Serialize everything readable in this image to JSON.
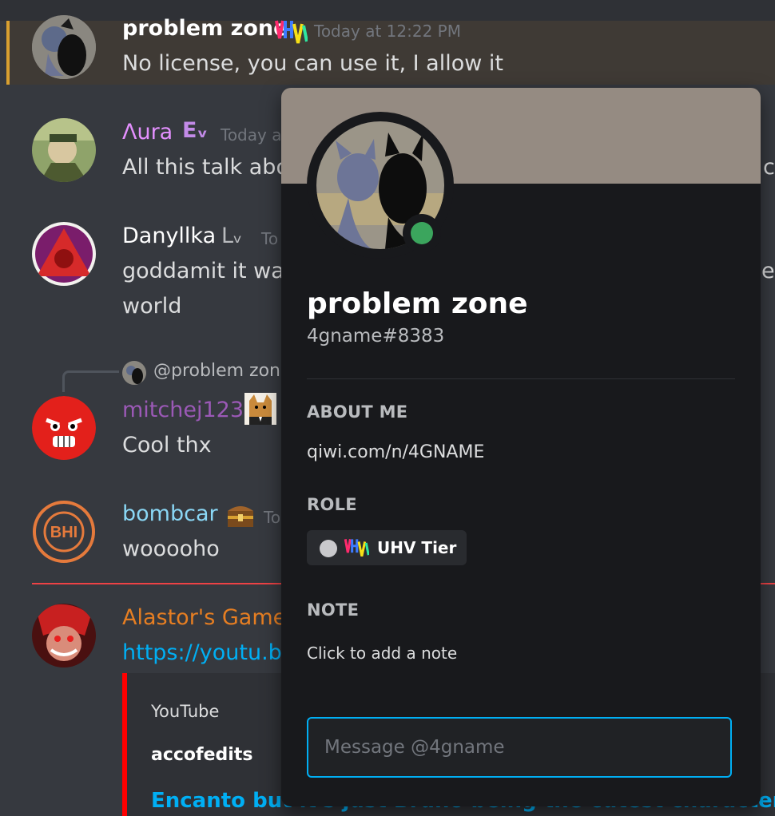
{
  "messages": [
    {
      "username": "problem zone",
      "time": "Today at 12:22 PM",
      "text": "No license, you can use it, I allow it",
      "color": "#ffffff"
    },
    {
      "username": "Λura",
      "badge": "Eᵥ",
      "time": "Today a",
      "text": "All this talk abo",
      "cut_text": "c",
      "color": "#e490ff"
    },
    {
      "username": "Danyllka",
      "badge": "Lᵥ",
      "time": "To",
      "text": "goddamit it was",
      "text2": "world",
      "cut_text": "e",
      "color": "#ffffff"
    },
    {
      "reply": "@problem zon",
      "username": "mitchej123",
      "text": "Cool thx",
      "color": "#9b59b6"
    },
    {
      "username": "bombcar",
      "time": "To",
      "text": "wooooho",
      "color": "#8ad7f5"
    },
    {
      "username": "Alastor's Game",
      "link": "https://youtu.b",
      "color": "#e67e22"
    }
  ],
  "embed": {
    "provider": "YouTube",
    "author": "accofedits",
    "title": "Encanto but it's just Bruno being the cutest character in"
  },
  "popout": {
    "name": "problem zone",
    "tag": "4gname#8383",
    "about_header": "ABOUT ME",
    "about_text": "qiwi.com/n/4GNAME",
    "role_header": "ROLE",
    "role_name": "UHV Tier",
    "note_header": "NOTE",
    "note_placeholder": "Click to add a note",
    "message_placeholder": "Message @4gname",
    "banner_color": "#958b82",
    "status_color": "#3ba55d"
  },
  "avatar_labels": {
    "bombcar": "BHI"
  }
}
